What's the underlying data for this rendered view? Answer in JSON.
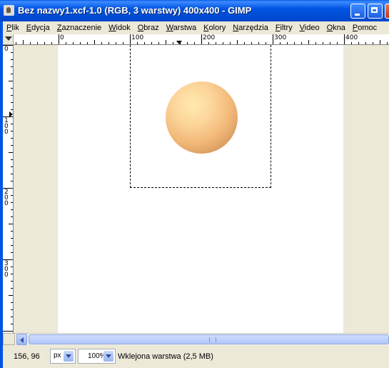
{
  "window": {
    "title": "Bez nazwy1.xcf-1.0 (RGB, 3 warstwy) 400x400 - GIMP"
  },
  "menu": [
    {
      "label": "Plik",
      "ul": "P",
      "rest": "lik"
    },
    {
      "label": "Edycja",
      "ul": "E",
      "rest": "dycja"
    },
    {
      "label": "Zaznaczenie",
      "ul": "Z",
      "rest": "aznaczenie"
    },
    {
      "label": "Widok",
      "ul": "W",
      "rest": "idok"
    },
    {
      "label": "Obraz",
      "ul": "O",
      "rest": "braz"
    },
    {
      "label": "Warstwa",
      "ul": "W",
      "rest": "arstwa"
    },
    {
      "label": "Kolory",
      "ul": "K",
      "rest": "olory"
    },
    {
      "label": "Narzędzia",
      "ul": "N",
      "rest": "arzędzia"
    },
    {
      "label": "Filtry",
      "ul": "F",
      "rest": "iltry"
    },
    {
      "label": "Video",
      "ul": "V",
      "rest": "ideo"
    },
    {
      "label": "Okna",
      "ul": "O",
      "rest": "kna"
    },
    {
      "label": "Pomoc",
      "ul": "P",
      "rest": "omoc"
    }
  ],
  "rulers": {
    "horizontal_labels": [
      "0",
      "100",
      "200",
      "300",
      "400"
    ],
    "vertical_labels": [
      "0",
      "100",
      "200",
      "300"
    ]
  },
  "status": {
    "coords": "156, 96",
    "unit": "px",
    "zoom": "100%",
    "layer_info": "Wklejona warstwa (2,5 MB)"
  },
  "colors": {
    "titlebar": "#0054e3",
    "canvas_bg": "#ece9d8",
    "sphere_light": "#ffeab0",
    "sphere_dark": "#8a6a48"
  }
}
